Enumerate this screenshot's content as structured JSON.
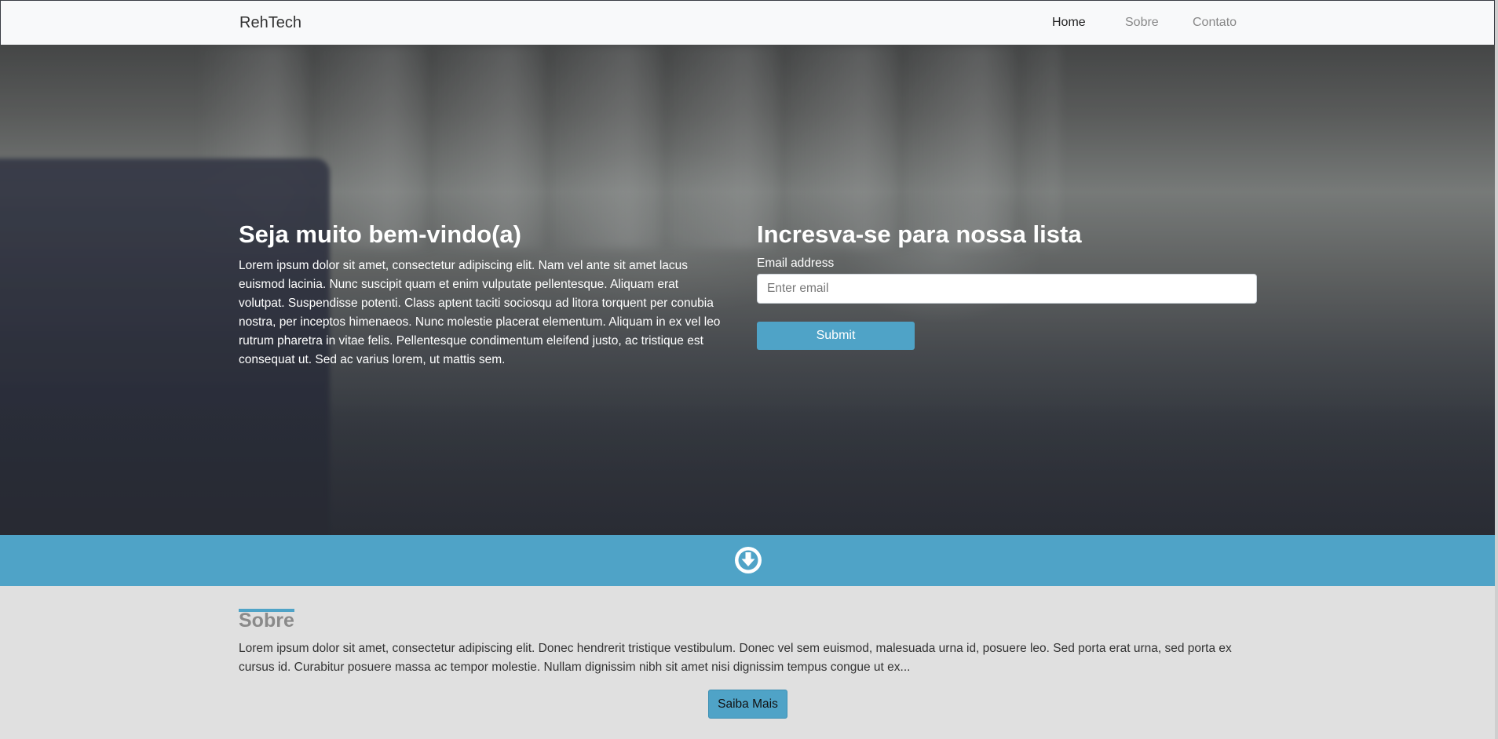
{
  "navbar": {
    "brand": "RehTech",
    "links": [
      {
        "label": "Home",
        "active": true
      },
      {
        "label": "Sobre",
        "active": false
      },
      {
        "label": "Contato",
        "active": false
      }
    ]
  },
  "hero": {
    "welcome_title": "Seja muito bem-vindo(a)",
    "welcome_text": "Lorem ipsum dolor sit amet, consectetur adipiscing elit. Nam vel ante sit amet lacus euismod lacinia. Nunc suscipit quam et enim vulputate pellentesque. Aliquam erat volutpat. Suspendisse potenti. Class aptent taciti sociosqu ad litora torquent per conubia nostra, per inceptos himenaeos. Nunc molestie placerat elementum. Aliquam in ex vel leo rutrum pharetra in vitae felis. Pellentesque condimentum eleifend justo, ac tristique est consequat ut. Sed ac varius lorem, ut mattis sem.",
    "signup_title": "Incresva-se para nossa lista",
    "email_label": "Email address",
    "email_placeholder": "Enter email",
    "email_value": "",
    "submit_label": "Submit"
  },
  "band": {
    "icon": "arrow-circle-down-icon"
  },
  "about": {
    "title": "Sobre",
    "text": "Lorem ipsum dolor sit amet, consectetur adipiscing elit. Donec hendrerit tristique vestibulum. Donec vel sem euismod, malesuada urna id, posuere leo. Sed porta erat urna, sed porta ex cursus id. Curabitur posuere massa ac tempor molestie. Nullam dignissim nibh sit amet nisi dignissim tempus congue ut ex...",
    "button_label": "Saiba Mais"
  },
  "colors": {
    "accent": "#4fa3c7",
    "navbar_bg": "#f8f9fa",
    "section_bg": "#e0e0e0"
  }
}
